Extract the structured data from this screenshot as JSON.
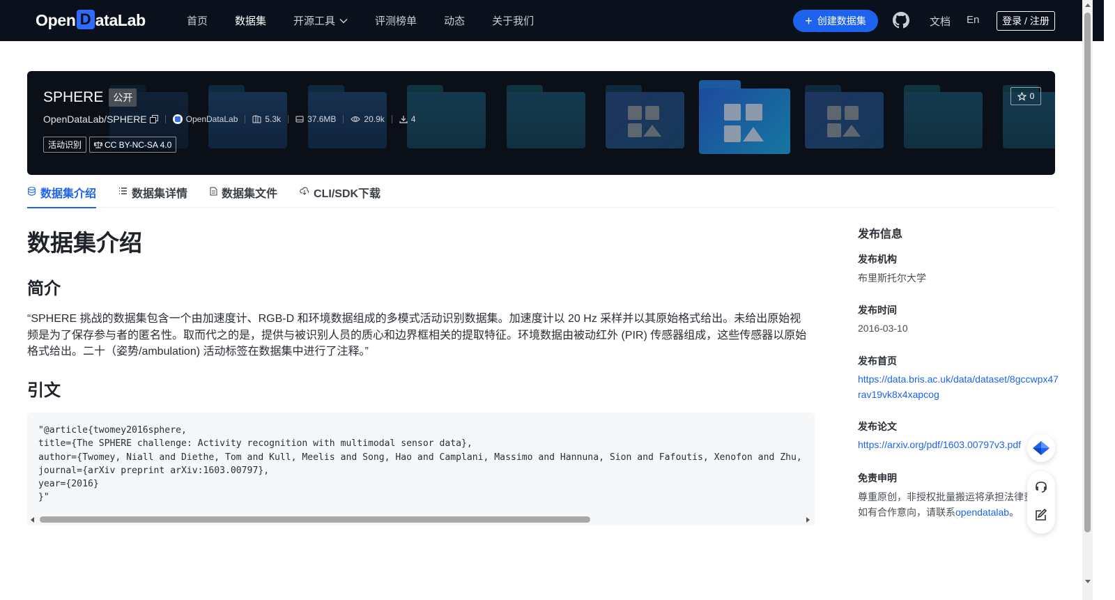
{
  "nav": {
    "brand": "OpenDataLab",
    "links": [
      {
        "label": "首页"
      },
      {
        "label": "数据集"
      },
      {
        "label": "开源工具"
      },
      {
        "label": "评测榜单"
      },
      {
        "label": "动态"
      },
      {
        "label": "关于我们"
      }
    ],
    "create_label": "创建数据集",
    "docs_label": "文档",
    "lang_label": "En",
    "login_label": "登录 / 注册"
  },
  "dataset": {
    "name": "SPHERE",
    "visibility": "公开",
    "path": "OpenDataLab/SPHERE",
    "org": "OpenDataLab",
    "stats": {
      "files": "5.3k",
      "size": "37.6MB",
      "views": "20.9k",
      "downloads": "4"
    },
    "tags": [
      "活动识别"
    ],
    "license": "CC BY-NC-SA 4.0",
    "stars": "0"
  },
  "tabs": [
    {
      "label": "数据集介绍",
      "icon": "database-icon"
    },
    {
      "label": "数据集详情",
      "icon": "list-icon"
    },
    {
      "label": "数据集文件",
      "icon": "file-icon"
    },
    {
      "label": "CLI/SDK下载",
      "icon": "cloud-download-icon"
    }
  ],
  "content": {
    "heading": "数据集介绍",
    "intro_heading": "简介",
    "intro_text": "“SPHERE 挑战的数据集包含一个由加速度计、RGB-D 和环境数据组成的多模式活动识别数据集。加速度计以 20 Hz 采样并以其原始格式给出。未给出原始视频是为了保存参与者的匿名性。取而代之的是，提供与被识别人员的质心和边界框相关的提取特征。环境数据由被动红外 (PIR) 传感器组成，这些传感器以原始格式给出。二十（姿势/ambulation) 活动标签在数据集中进行了注释。”",
    "citation_heading": "引文",
    "citation_code": "\"@article{twomey2016sphere,\ntitle={The SPHERE challenge: Activity recognition with multimodal sensor data},\nauthor={Twomey, Niall and Diethe, Tom and Kull, Meelis and Song, Hao and Camplani, Massimo and Hannuna, Sion and Fafoutis, Xenofon and Zhu,\njournal={arXiv preprint arXiv:1603.00797},\nyear={2016}\n}\""
  },
  "sidebar": {
    "title": "发布信息",
    "org_label": "发布机构",
    "org_value": "布里斯托尔大学",
    "time_label": "发布时间",
    "time_value": "2016-03-10",
    "home_label": "发布首页",
    "home_value": "https://data.bris.ac.uk/data/dataset/8gccwpx47rav19vk8x4xapcog",
    "paper_label": "发布论文",
    "paper_value": "https://arxiv.org/pdf/1603.00797v3.pdf",
    "disclaimer_label": "免责申明",
    "disclaimer_line1": "尊重原创，非授权批量搬运将承担法律责",
    "disclaimer_line2_prefix": "如有合作意向，请联系",
    "disclaimer_link": "opendatalab",
    "disclaimer_line2_suffix": "。"
  },
  "colors": {
    "nav_bg": "#0a101c",
    "accent": "#1d63ed",
    "banner_bg": "#0b0f17"
  }
}
